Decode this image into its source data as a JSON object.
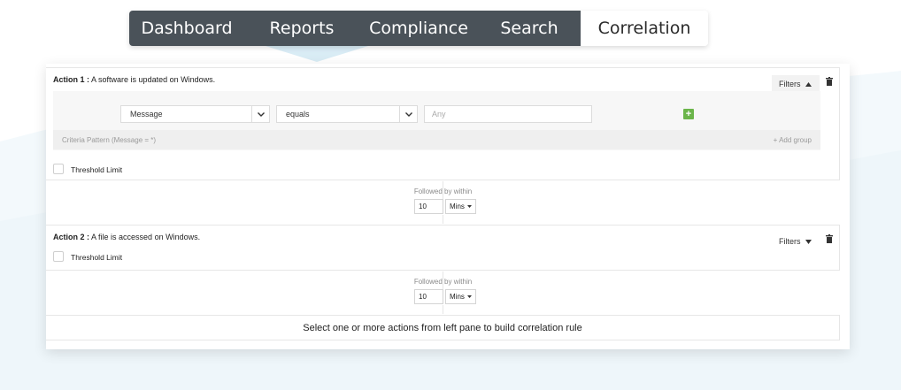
{
  "tabs": [
    {
      "label": "Dashboard",
      "active": false
    },
    {
      "label": "Reports",
      "active": false
    },
    {
      "label": "Compliance",
      "active": false
    },
    {
      "label": "Search",
      "active": false
    },
    {
      "label": "Correlation",
      "active": true
    }
  ],
  "actions": [
    {
      "number_label": "Action 1 :",
      "description": "A software is updated on Windows.",
      "filters_label": "Filters",
      "filters_expanded": true,
      "criteria": {
        "field_value": "Message",
        "operator_value": "equals",
        "value_placeholder": "Any",
        "pattern_label": "Criteria Pattern (Message = *)",
        "add_group_label": "+ Add group"
      },
      "threshold_label": "Threshold Limit"
    },
    {
      "number_label": "Action 2 :",
      "description": "A file is accessed on Windows.",
      "filters_label": "Filters",
      "filters_expanded": false,
      "threshold_label": "Threshold Limit"
    }
  ],
  "followed_by": [
    {
      "label": "Followed by within",
      "value": "10",
      "unit": "Mins"
    },
    {
      "label": "Followed by within",
      "value": "10",
      "unit": "Mins"
    }
  ],
  "hint": "Select one or more actions from left pane to build correlation rule",
  "icons": {
    "filters_open": "caret-up-icon",
    "filters_closed": "caret-down-icon",
    "delete": "trash-icon",
    "add": "plus-icon",
    "dropdown": "chevron-down-icon"
  },
  "colors": {
    "tab_bg": "#4a5259",
    "tab_active_bg": "#ffffff",
    "add_button": "#6bb54a",
    "accent_wave": "#e3f1f8"
  }
}
